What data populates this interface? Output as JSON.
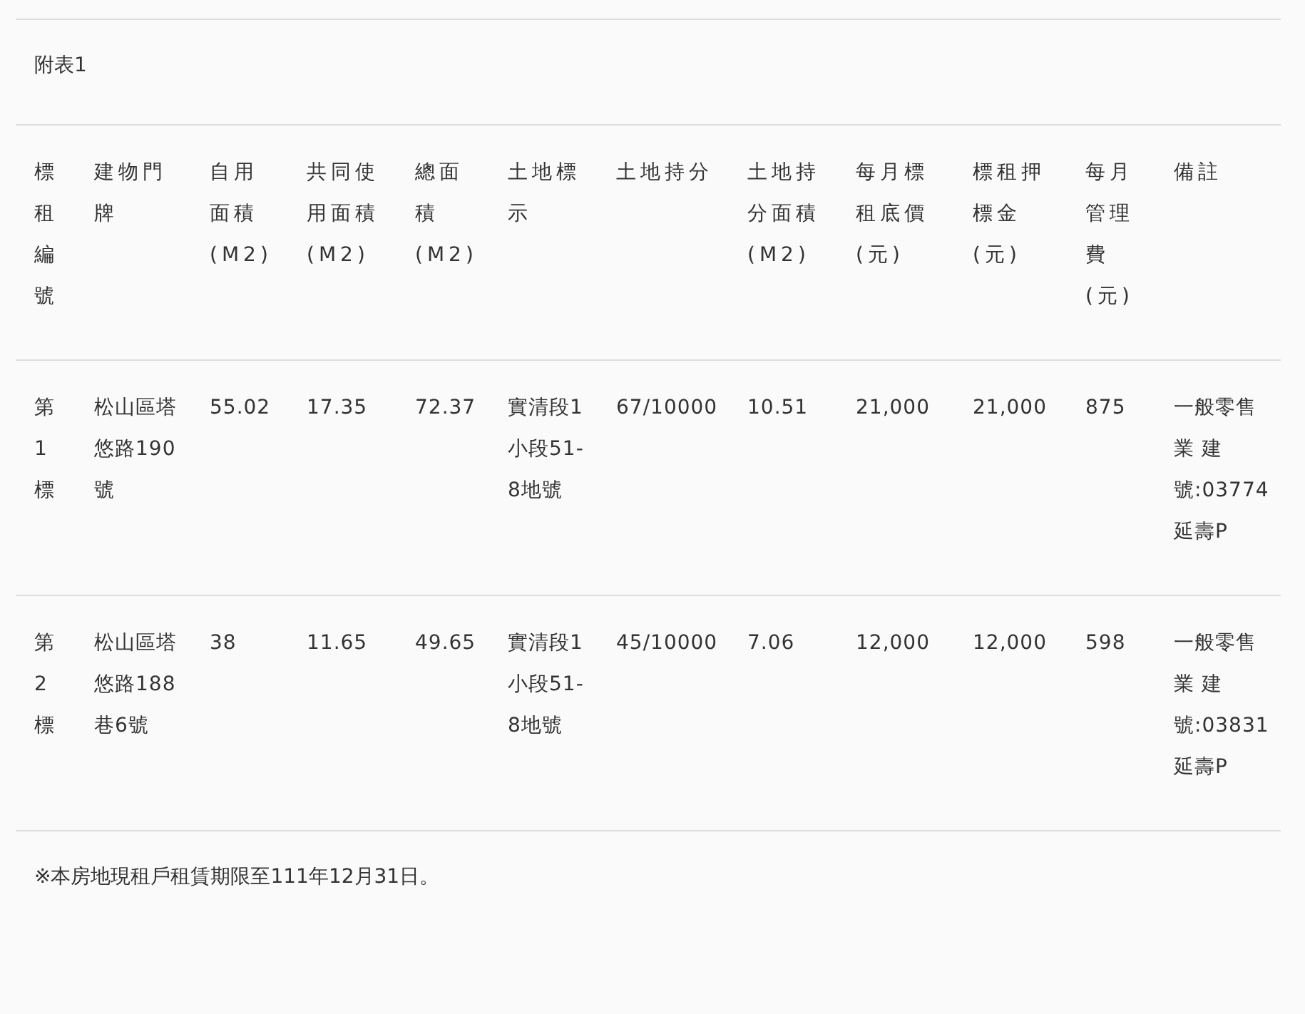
{
  "caption": "附表1",
  "table": {
    "columns": [
      "標租編號",
      "建物門牌",
      "自用面積(M2)",
      "共同使用面積(M2)",
      "總面積(M2)",
      "土地標示",
      "土地持分",
      "土地持分面積(M2)",
      "每月標租底價(元)",
      "標租押標金(元)",
      "每月管理費(元)",
      "備註"
    ],
    "rows": [
      {
        "cells": [
          "第1標",
          "松山區塔悠路190號",
          "55.02",
          "17.35",
          "72.37",
          "實清段1小段51-8地號",
          "67/10000",
          "10.51",
          "21,000",
          "21,000",
          "875",
          "一般零售業 建號:03774 延壽P"
        ]
      },
      {
        "cells": [
          "第2標",
          "松山區塔悠路188巷6號",
          "38",
          "11.65",
          "49.65",
          "實清段1小段51-8地號",
          "45/10000",
          "7.06",
          "12,000",
          "12,000",
          "598",
          "一般零售業 建號:03831 延壽P"
        ]
      }
    ]
  },
  "note": "※本房地現租戶租賃期限至111年12月31日。"
}
